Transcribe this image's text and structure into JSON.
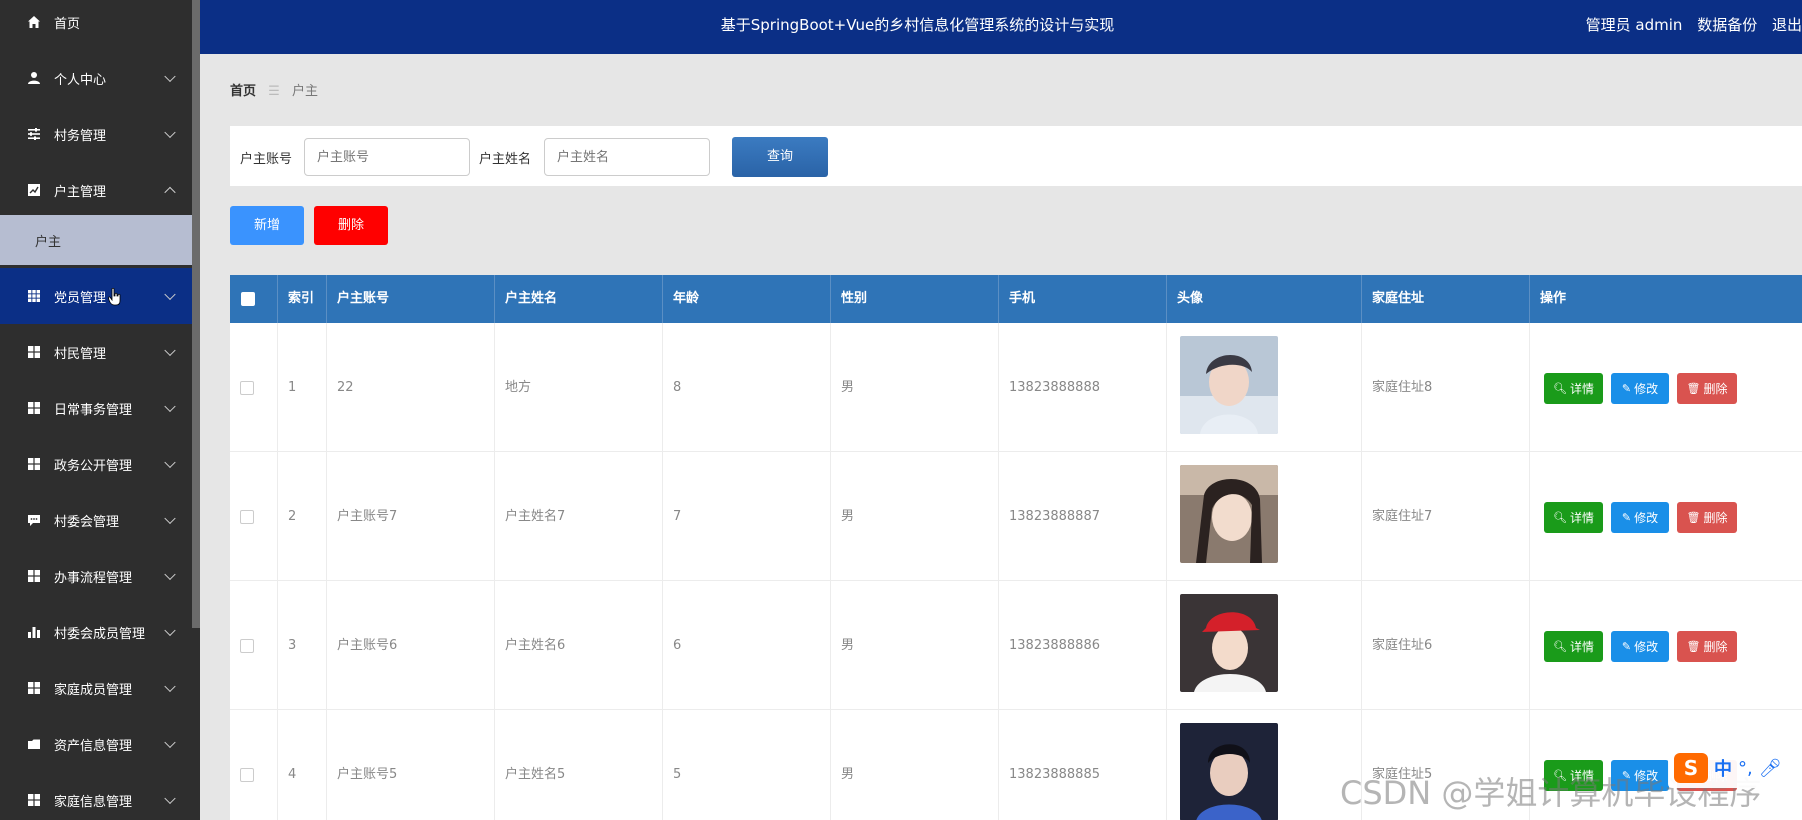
{
  "header": {
    "title": "基于SpringBoot+Vue的乡村信息化管理系统的设计与实现",
    "user": "管理员 admin",
    "backup": "数据备份",
    "logout": "退出"
  },
  "sidebar": {
    "items": [
      {
        "label": "首页",
        "icon": "home-icon",
        "arrow": ""
      },
      {
        "label": "个人中心",
        "icon": "user-icon",
        "arrow": "down"
      },
      {
        "label": "村务管理",
        "icon": "sliders-icon",
        "arrow": "down"
      },
      {
        "label": "户主管理",
        "icon": "chart-icon",
        "arrow": "up"
      },
      {
        "label": "党员管理",
        "icon": "grid-icon",
        "arrow": "down"
      },
      {
        "label": "村民管理",
        "icon": "grid-icon",
        "arrow": "down"
      },
      {
        "label": "日常事务管理",
        "icon": "grid-icon",
        "arrow": "down"
      },
      {
        "label": "政务公开管理",
        "icon": "grid-icon",
        "arrow": "down"
      },
      {
        "label": "村委会管理",
        "icon": "comment-icon",
        "arrow": "down"
      },
      {
        "label": "办事流程管理",
        "icon": "grid-icon",
        "arrow": "down"
      },
      {
        "label": "村委会成员管理",
        "icon": "bar-chart-icon",
        "arrow": "down"
      },
      {
        "label": "家庭成员管理",
        "icon": "grid-icon",
        "arrow": "down"
      },
      {
        "label": "资产信息管理",
        "icon": "folder-icon",
        "arrow": "down"
      },
      {
        "label": "家庭信息管理",
        "icon": "grid-icon",
        "arrow": "down"
      }
    ],
    "submenu_item": "户主"
  },
  "breadcrumb": {
    "home": "首页",
    "current": "户主"
  },
  "search": {
    "account_label": "户主账号",
    "account_placeholder": "户主账号",
    "name_label": "户主姓名",
    "name_placeholder": "户主姓名",
    "query_button": "查询"
  },
  "actions": {
    "add": "新增",
    "delete": "删除"
  },
  "table": {
    "columns": [
      "索引",
      "户主账号",
      "户主姓名",
      "年龄",
      "性别",
      "手机",
      "头像",
      "家庭住址",
      "操作"
    ],
    "rows": [
      {
        "index": "1",
        "account": "22",
        "name": "地方",
        "age": "8",
        "gender": "男",
        "phone": "13823888888",
        "address": "家庭住址8"
      },
      {
        "index": "2",
        "account": "户主账号7",
        "name": "户主姓名7",
        "age": "7",
        "gender": "男",
        "phone": "13823888887",
        "address": "家庭住址7"
      },
      {
        "index": "3",
        "account": "户主账号6",
        "name": "户主姓名6",
        "age": "6",
        "gender": "男",
        "phone": "13823888886",
        "address": "家庭住址6"
      },
      {
        "index": "4",
        "account": "户主账号5",
        "name": "户主姓名5",
        "age": "5",
        "gender": "男",
        "phone": "13823888885",
        "address": "家庭住址5"
      }
    ],
    "row_actions": {
      "detail": "详情",
      "edit": "修改",
      "remove": "删除"
    }
  },
  "watermark": "CSDN @学姐计算机毕设程序",
  "ime": {
    "logo": "S",
    "mode": "中"
  }
}
